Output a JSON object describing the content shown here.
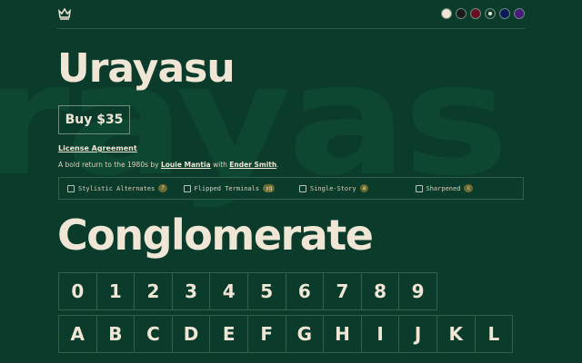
{
  "background_word": "rayas",
  "header": {
    "logo_icon": "crown-icon",
    "swatches": [
      {
        "name": "light",
        "color": "#efe6d6",
        "selected": false
      },
      {
        "name": "black",
        "color": "#1a1a1a",
        "selected": false
      },
      {
        "name": "maroon",
        "color": "#6b1024",
        "selected": false
      },
      {
        "name": "green",
        "color": "#0b3b2a",
        "selected": true
      },
      {
        "name": "navy",
        "color": "#0c1a5a",
        "selected": false
      },
      {
        "name": "purple",
        "color": "#4a1a7a",
        "selected": false
      }
    ]
  },
  "font_name": "Urayasu",
  "buy_label": "Buy $35",
  "license_link": "License Agreement",
  "description": {
    "prefix": "A bold return to the 1980s by ",
    "author": "Louie Mantia",
    "middle": " with ",
    "collaborator": "Ender Smith",
    "suffix": "."
  },
  "features": [
    {
      "label": "Stylistic Alternates",
      "key": "?"
    },
    {
      "label": "Flipped Terminals",
      "key": "yg"
    },
    {
      "label": "Single-Story",
      "key": "a"
    },
    {
      "label": "Sharpened",
      "key": "c"
    }
  ],
  "sample_text": "Conglomerate",
  "digits": [
    "0",
    "1",
    "2",
    "3",
    "4",
    "5",
    "6",
    "7",
    "8",
    "9"
  ],
  "letters": [
    "A",
    "B",
    "C",
    "D",
    "E",
    "F",
    "G",
    "H",
    "I",
    "J",
    "K",
    "L"
  ],
  "colors": {
    "background": "#0b3b2a",
    "text": "#efe6d6",
    "accent": "#6d6b2e"
  }
}
